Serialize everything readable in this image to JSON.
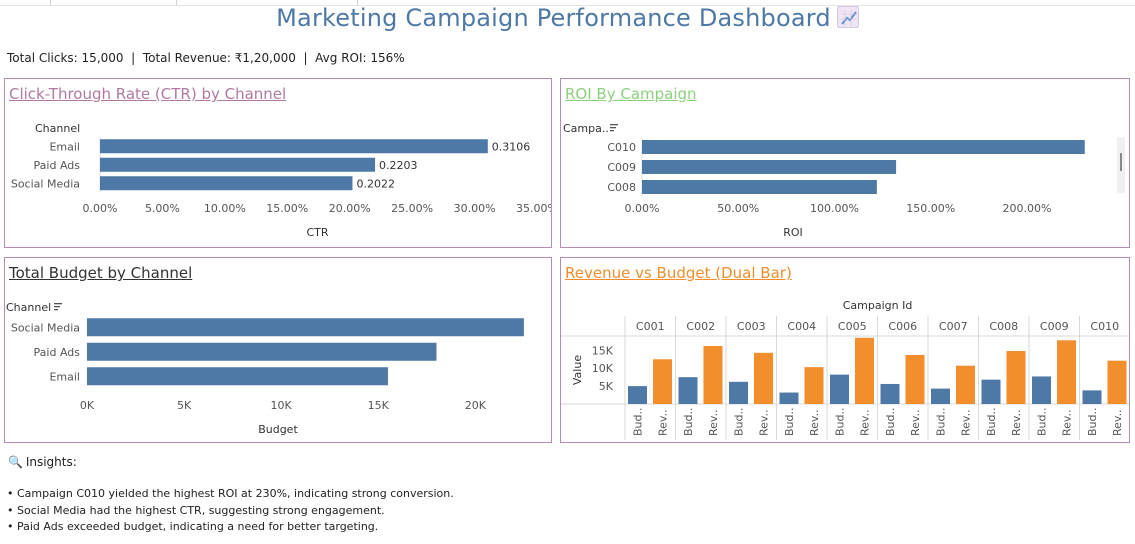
{
  "page": {
    "title": "Marketing Campaign Performance Dashboard",
    "title_icon": "chart-increasing-icon",
    "summary": "Total Clicks: 15,000  |  Total Revenue: ₹1,20,000  |  Avg ROI: 156%"
  },
  "colors": {
    "bar_blue": "#4e79a7",
    "bar_orange": "#f28e2b",
    "title_blue": "#4e79a7",
    "panel_border": "#b48cb4"
  },
  "insights": {
    "heading": "Insights:",
    "heading_icon": "magnifier-icon",
    "items": [
      "• Campaign C010 yielded the highest ROI at 230%, indicating strong conversion.",
      "• Social Media had the highest CTR, suggesting strong engagement.",
      "• Paid Ads exceeded budget, indicating a need for better targeting."
    ]
  },
  "chart_data": [
    {
      "type": "bar",
      "orientation": "horizontal",
      "title": "Click-Through Rate (CTR) by Channel",
      "title_color": "#b07aa1",
      "category_header": "Channel",
      "categories": [
        "Email",
        "Paid Ads",
        "Social Media"
      ],
      "values": [
        0.3106,
        0.2203,
        0.2022
      ],
      "data_labels": [
        "0.3106",
        "0.2203",
        "0.2022"
      ],
      "xlabel": "CTR",
      "xlim": [
        0,
        0.35
      ],
      "ticks": [
        0,
        0.05,
        0.1,
        0.15,
        0.2,
        0.25,
        0.3,
        0.35
      ],
      "tick_labels": [
        "0.00%",
        "5.00%",
        "10.00%",
        "15.00%",
        "20.00%",
        "25.00%",
        "30.00%",
        "35.00%"
      ]
    },
    {
      "type": "bar",
      "orientation": "horizontal",
      "title": "ROI By Campaign",
      "title_color": "#8cd17d",
      "category_header": "Campa..",
      "categories": [
        "C010",
        "C009",
        "C008"
      ],
      "values": [
        2.3,
        1.32,
        1.22
      ],
      "xlabel": "ROI",
      "xlim": [
        0,
        2.4
      ],
      "ticks": [
        0,
        0.5,
        1.0,
        1.5,
        2.0
      ],
      "tick_labels": [
        "0.00%",
        "50.00%",
        "100.00%",
        "150.00%",
        "200.00%"
      ]
    },
    {
      "type": "bar",
      "orientation": "horizontal",
      "title": "Total Budget by Channel",
      "title_color": "#333333",
      "category_header": "Channel",
      "categories": [
        "Social Media",
        "Paid Ads",
        "Email"
      ],
      "values": [
        22500,
        18000,
        15500
      ],
      "xlabel": "Budget",
      "xlim": [
        0,
        24000
      ],
      "ticks": [
        0,
        5000,
        10000,
        15000,
        20000
      ],
      "tick_labels": [
        "0K",
        "5K",
        "10K",
        "15K",
        "20K"
      ]
    },
    {
      "type": "bar",
      "title": "Revenue vs Budget (Dual Bar)",
      "title_color": "#f28e2b",
      "column_header": "Campaign Id",
      "categories": [
        "C001",
        "C002",
        "C003",
        "C004",
        "C005",
        "C006",
        "C007",
        "C008",
        "C009",
        "C010"
      ],
      "sub_labels": [
        "Bud..",
        "Rev.."
      ],
      "series": [
        {
          "name": "Budget",
          "color": "#4e79a7",
          "values": [
            5000,
            7500,
            6200,
            3200,
            8200,
            5600,
            4300,
            6800,
            7700,
            3800
          ]
        },
        {
          "name": "Revenue",
          "color": "#f28e2b",
          "values": [
            12500,
            16200,
            14300,
            10300,
            18500,
            13700,
            10700,
            14800,
            17800,
            12100
          ]
        }
      ],
      "ylabel": "Value",
      "ylim": [
        0,
        19000
      ],
      "ticks": [
        5000,
        10000,
        15000
      ],
      "tick_labels": [
        "5K",
        "10K",
        "15K"
      ]
    }
  ]
}
